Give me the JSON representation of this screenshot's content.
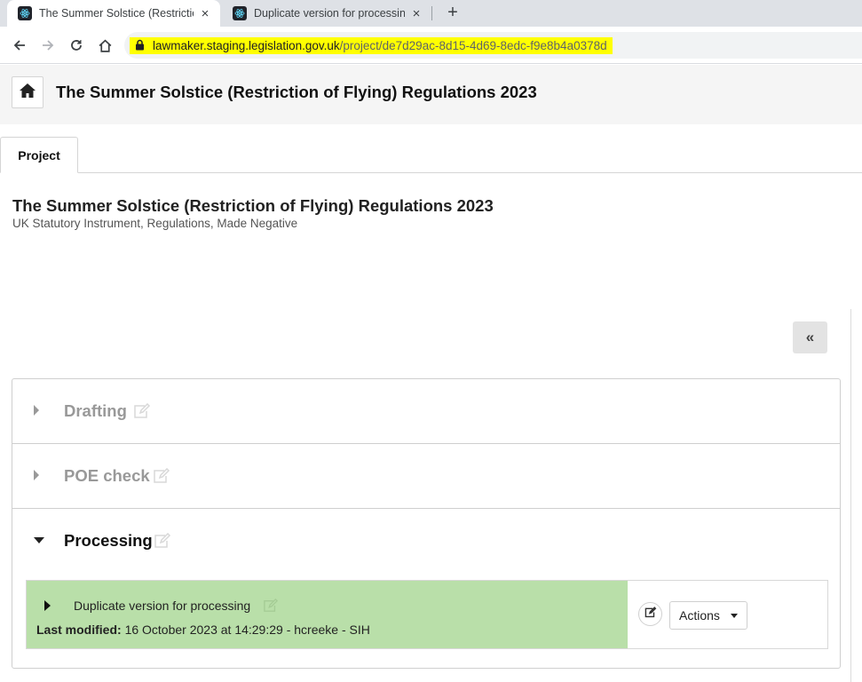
{
  "browser": {
    "tabs": [
      {
        "title": "The Summer Solstice (Restriction",
        "active": true
      },
      {
        "title": "Duplicate version for processing",
        "active": false
      }
    ],
    "new_tab": "+",
    "close_glyph": "×",
    "url_host": "lawmaker.staging.legislation.gov.uk",
    "url_path": "/project/de7d29ac-8d15-4d69-8edc-f9e8b4a0378d",
    "url_highlight_color": "#ffff00",
    "icons": [
      "back-arrow-icon",
      "forward-arrow-icon",
      "reload-icon",
      "home-icon",
      "lock-icon",
      "react-favicon-icon"
    ]
  },
  "header": {
    "title": "The Summer Solstice (Restriction of Flying) Regulations 2023",
    "home_icon": "home-icon"
  },
  "page_tabs": [
    {
      "label": "Project",
      "active": true
    }
  ],
  "project": {
    "title": "The Summer Solstice (Restriction of Flying) Regulations 2023",
    "subtitle": "UK Statutory Instrument, Regulations, Made Negative"
  },
  "panel_toggle": {
    "label": "«"
  },
  "stages": [
    {
      "label": "Drafting",
      "expanded": false
    },
    {
      "label": "POE check",
      "expanded": false
    },
    {
      "label": "Processing",
      "expanded": true
    }
  ],
  "version": {
    "title": "Duplicate version for processing",
    "modified_label": "Last modified:",
    "modified_value": "16 October 2023 at 14:29:29 - hcreeke - SIH",
    "actions_label": "Actions",
    "highlight_color": "#b9dfa9"
  }
}
